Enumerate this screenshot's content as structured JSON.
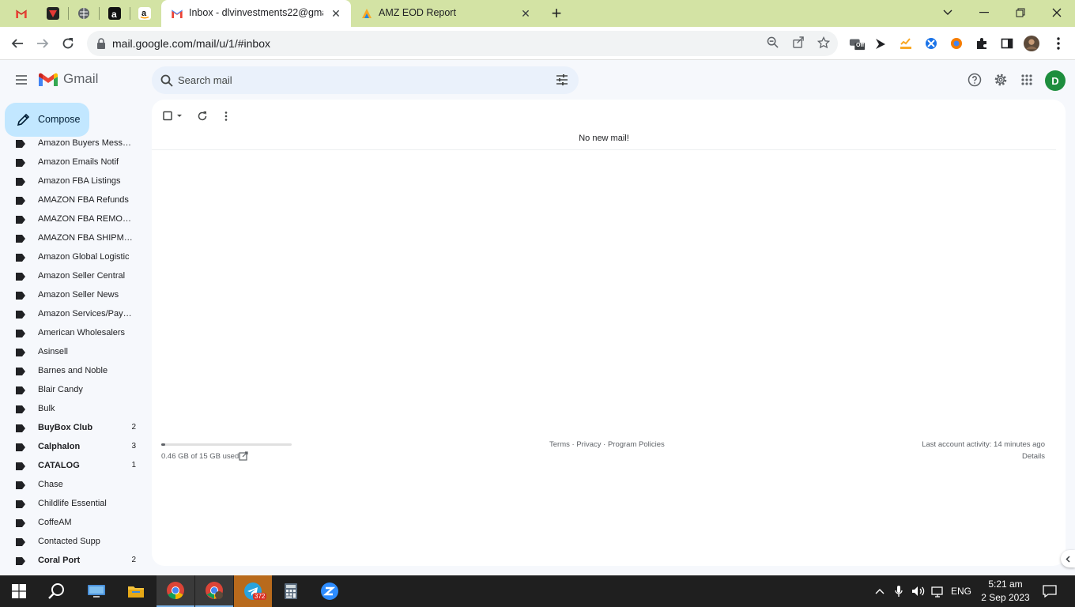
{
  "browser": {
    "tabs": [
      {
        "title": "Inbox - dlvinvestments22@gmail.com",
        "active": true
      },
      {
        "title": "AMZ EOD Report",
        "active": false
      }
    ],
    "url": "mail.google.com/mail/u/1/#inbox",
    "extension_off_badge": "Off"
  },
  "gmail": {
    "app_name": "Gmail",
    "search_placeholder": "Search mail",
    "avatar_initial": "D",
    "compose_label": "Compose",
    "labels": [
      {
        "name": "Amazon Buyers Messag...",
        "count": "",
        "bold": false
      },
      {
        "name": "Amazon Emails Notif",
        "count": "",
        "bold": false
      },
      {
        "name": "Amazon FBA Listings",
        "count": "",
        "bold": false
      },
      {
        "name": "AMAZON FBA Refunds",
        "count": "",
        "bold": false
      },
      {
        "name": "AMAZON FBA REMOVAL",
        "count": "",
        "bold": false
      },
      {
        "name": "AMAZON FBA SHIPMEN...",
        "count": "",
        "bold": false
      },
      {
        "name": "Amazon Global Logistic",
        "count": "",
        "bold": false
      },
      {
        "name": "Amazon Seller Central",
        "count": "",
        "bold": false
      },
      {
        "name": "Amazon Seller News",
        "count": "",
        "bold": false
      },
      {
        "name": "Amazon Services/Paym...",
        "count": "",
        "bold": false
      },
      {
        "name": "American Wholesalers",
        "count": "",
        "bold": false
      },
      {
        "name": "Asinsell",
        "count": "",
        "bold": false
      },
      {
        "name": "Barnes and Noble",
        "count": "",
        "bold": false
      },
      {
        "name": "Blair Candy",
        "count": "",
        "bold": false
      },
      {
        "name": "Bulk",
        "count": "",
        "bold": false
      },
      {
        "name": "BuyBox Club",
        "count": "2",
        "bold": true
      },
      {
        "name": "Calphalon",
        "count": "3",
        "bold": true
      },
      {
        "name": "CATALOG",
        "count": "1",
        "bold": true
      },
      {
        "name": "Chase",
        "count": "",
        "bold": false
      },
      {
        "name": "Childlife Essential",
        "count": "",
        "bold": false
      },
      {
        "name": "CoffeAM",
        "count": "",
        "bold": false
      },
      {
        "name": "Contacted Supp",
        "count": "",
        "bold": false
      },
      {
        "name": "Coral Port",
        "count": "2",
        "bold": true
      }
    ],
    "empty_message": "No new mail!",
    "storage": {
      "text": "0.46 GB of 15 GB used",
      "used_fraction": 0.03
    },
    "footer": {
      "terms": "Terms",
      "privacy": "Privacy",
      "policies": "Program Policies",
      "separator": " · "
    },
    "last_activity": "Last account activity: 14 minutes ago",
    "details": "Details"
  },
  "taskbar": {
    "telegram_badge": "372",
    "language": "ENG",
    "time": "5:21 am",
    "date": "2 Sep 2023"
  },
  "colors": {
    "tab_strip": "#d3e3a4",
    "compose_bg": "#c2e7ff",
    "search_bg": "#eaf1fb",
    "avatar": "#1e8e3e"
  }
}
